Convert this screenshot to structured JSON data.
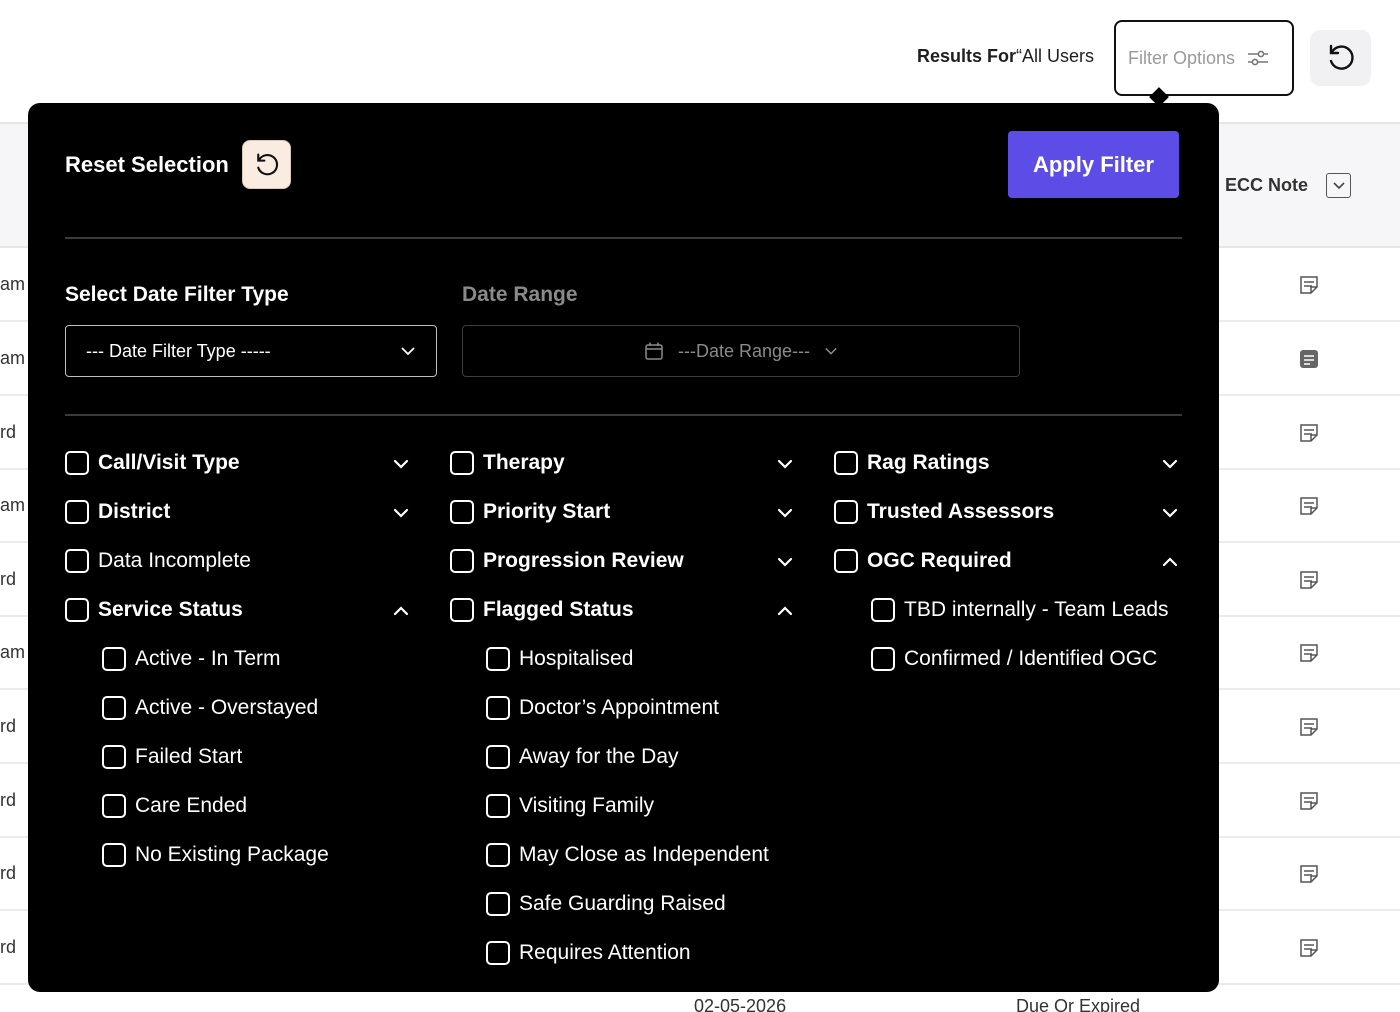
{
  "header": {
    "results_prefix": "Results For",
    "results_value": "“All Users",
    "filter_placeholder": "Filter Options",
    "icons": [
      "sliders-icon",
      "reset-icon"
    ]
  },
  "table": {
    "column_ecc": "ECC Note",
    "row_left_text": [
      "am",
      "am",
      "rd",
      "am",
      "rd",
      "am",
      "rd",
      "rd",
      "rd",
      "rd"
    ],
    "bottom_date": "02-05-2026",
    "bottom_status": "Due Or Expired"
  },
  "panel": {
    "reset_label": "Reset Selection",
    "apply_label": "Apply Filter",
    "date_type_label": "Select Date Filter Type",
    "date_type_value": "--- Date Filter Type -----",
    "date_range_label": "Date Range",
    "date_range_value": "---Date Range---",
    "col1": {
      "call_visit": "Call/Visit Type",
      "district": "District",
      "data_incomplete": "Data Incomplete",
      "service_status": "Service Status",
      "service_items": [
        "Active - In Term",
        "Active - Overstayed",
        "Failed Start",
        "Care Ended",
        "No Existing Package"
      ]
    },
    "col2": {
      "therapy": "Therapy",
      "priority_start": "Priority Start",
      "progression_review": "Progression Review",
      "flagged_status": "Flagged Status",
      "flagged_items": [
        "Hospitalised",
        "Doctor’s Appointment",
        "Away for the Day",
        "Visiting Family",
        "May Close as Independent",
        "Safe Guarding Raised",
        "Requires Attention"
      ]
    },
    "col3": {
      "rag_ratings": "Rag Ratings",
      "trusted_assessors": "Trusted Assessors",
      "ogc_required": "OGC Required",
      "ogc_items": [
        "TBD internally - Team Leads",
        "Confirmed / Identified OGC"
      ]
    }
  },
  "colors": {
    "apply_button": "#5b4de6",
    "panel_background": "#000000",
    "reset_button_bg": "#fbece2"
  }
}
